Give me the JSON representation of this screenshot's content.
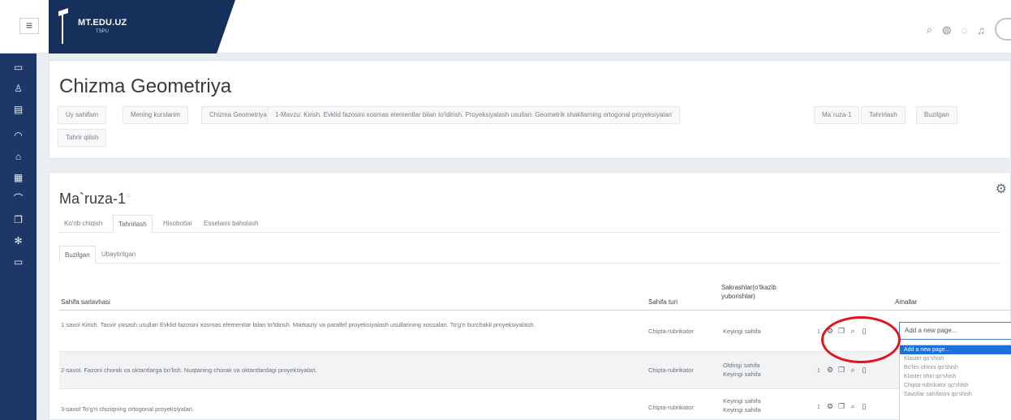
{
  "topbar": {
    "menu_icon": "hamburger-icon",
    "brand_title": "MT.EDU.UZ",
    "brand_sub": "TSPU",
    "icons": [
      "search-icon",
      "globe-icon",
      "chat-icon",
      "bell-icon"
    ]
  },
  "sidebar": {
    "icons": [
      "folder-icon",
      "users-icon",
      "book-icon",
      "dashboard-icon",
      "home-icon",
      "calendar-icon",
      "graduation-icon",
      "files-icon",
      "settings-icon",
      "folder-icon"
    ]
  },
  "header": {
    "title": "Chizma Geometriya",
    "breadcrumbs": [
      "Uy sahifam",
      "Mening kurslarim",
      "Chizma Geometriya",
      "1-Mavzu: Kirish. Evklid fazosini xosmas elementlar bilan to'ldirish. Proyeksiyalash usullari. Geometrik shakllarning ortogonal proyeksiyalari",
      "Ma`ruza-1",
      "Tahrirlash",
      "Buzilgan",
      "Tahrir qilish"
    ]
  },
  "module": {
    "title": "Ma`ruza-1",
    "tabs": [
      "Ko'rib chiqish",
      "Tahrirlash",
      "Hisobotlar",
      "Esselarni baholash"
    ],
    "subtabs": [
      "Buzilgan",
      "Ubaytirilgan"
    ]
  },
  "table": {
    "headers": {
      "title": "Sahifa sarlavhasi",
      "type": "Sahifa turi",
      "jumps": "Sakrashlar(o'tkazib yuborishlar)",
      "actions": "Amallar"
    },
    "rows": [
      {
        "title": "1 savol Kirish. Tasvir yasash usullari Evklid fazosini xosmas elementlar bilan to'ldirish. Markaziy va parallel proyeksiyalash usullarining xossalari. To'g'ri burchakli proyeksiyalash.",
        "type": "Chipta-rubrikator",
        "jumps": [
          "Keyingi sahifa"
        ]
      },
      {
        "title": "2-savol. Fazoni chorak va oktantlarga bo'lish. Nuqtaning chorak va oktantlardagi proyeksiyalari.",
        "type": "Chipta-rubrikator",
        "jumps": [
          "Oldingi sahifa",
          "Keyingi sahifa"
        ]
      },
      {
        "title": "3-savol To'g'ri chiziqning ortogonal proyeksiyalari.",
        "type": "Chipta-rubrikator",
        "jumps": [
          "Keyingi sahifa",
          "Keyingi sahifa"
        ]
      }
    ],
    "action_icons": [
      "move-icon",
      "settings-icon",
      "copy-icon",
      "preview-icon",
      "delete-icon"
    ]
  },
  "add_page": {
    "placeholder": "Add a new page...",
    "options": [
      "Add a new page...",
      "Klaster qo'shish",
      "Bo'lim ohirini qo'shish",
      "Klaster ohiri qo'shish",
      "Chipta-rubrikator qo'shish",
      "Savollar sahifasini qo'shish"
    ]
  },
  "colors": {
    "sidebar": "#1d3766",
    "brand": "#16305c",
    "highlight": "#1e6fd9",
    "annotation": "#e0141e"
  }
}
